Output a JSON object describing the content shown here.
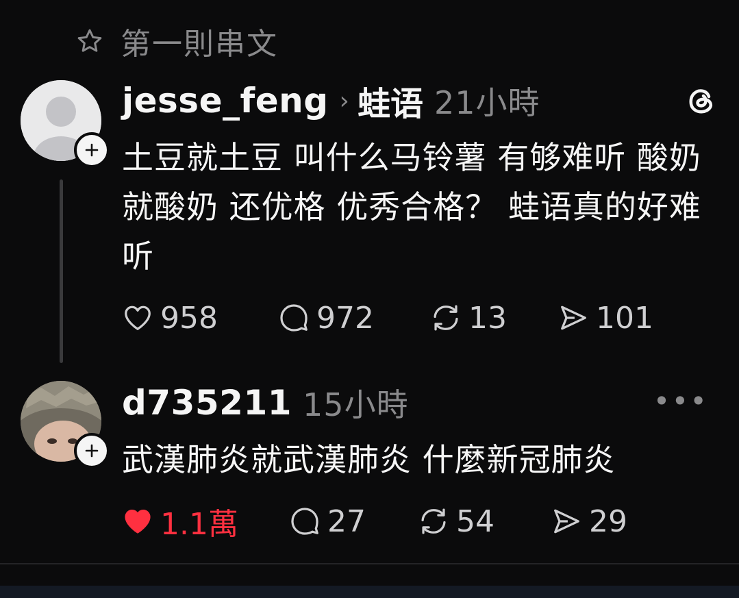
{
  "topbar": {
    "title": "第一則串文"
  },
  "posts": [
    {
      "username": "jesse_feng",
      "community": "蛙语",
      "time": "21小時",
      "text": "土豆就土豆 叫什么马铃薯 有够难听 酸奶就酸奶 还优格 优秀合格？ 蛙语真的好难听",
      "likes": "958",
      "comments": "972",
      "reposts": "13",
      "shares": "101"
    },
    {
      "username": "d735211",
      "time": "15小時",
      "text": "武漢肺炎就武漢肺炎 什麼新冠肺炎",
      "likes": "1.1萬",
      "comments": "27",
      "reposts": "54",
      "shares": "29"
    }
  ],
  "colors": {
    "background": "#0b0b0c",
    "text": "#f5f5f5",
    "muted": "#8a8a8c",
    "liked": "#ff3040"
  },
  "icons": [
    "star-icon",
    "threads-logo-icon",
    "more-icon",
    "heart-icon",
    "comment-icon",
    "repost-icon",
    "share-icon",
    "plus-icon"
  ]
}
